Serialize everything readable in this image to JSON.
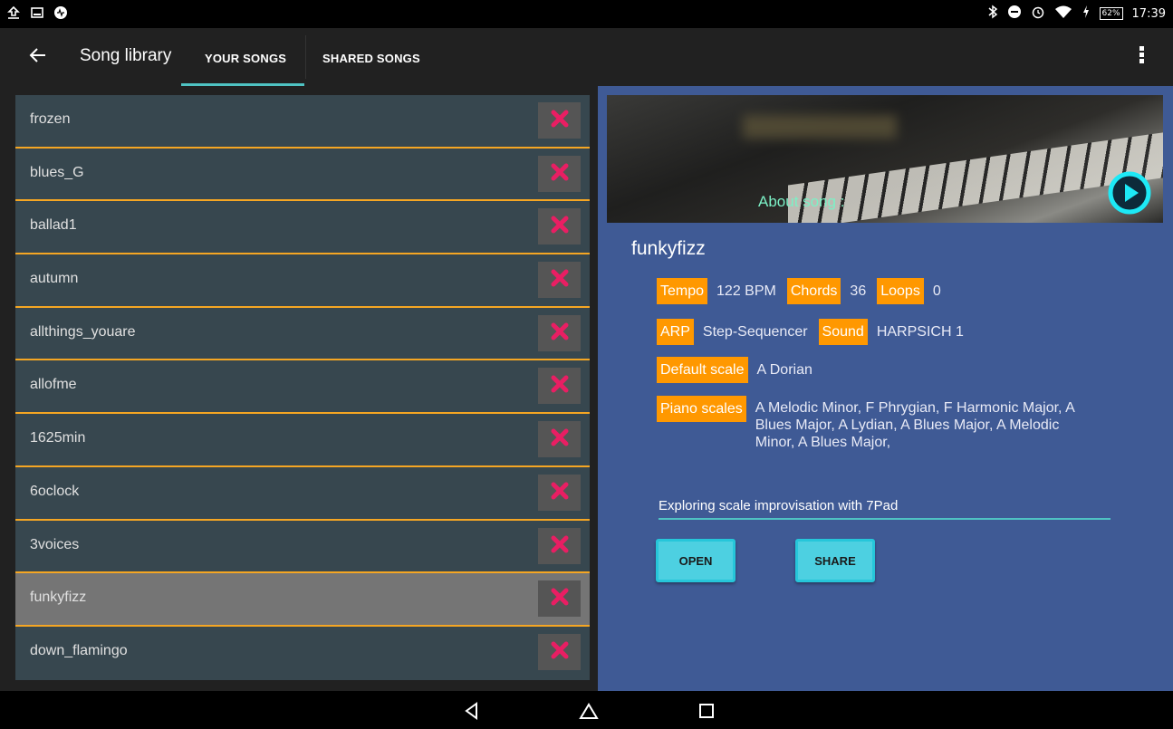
{
  "status_bar": {
    "left_icons": [
      "upload-icon",
      "image-icon",
      "app-notification-icon"
    ],
    "right_icons": [
      "bluetooth-icon",
      "do-not-disturb-icon",
      "alarm-icon",
      "wifi-icon",
      "charging-icon"
    ],
    "battery": "62%",
    "time": "17:39"
  },
  "app_bar": {
    "title": "Song library",
    "tabs": [
      {
        "label": "YOUR SONGS",
        "active": true
      },
      {
        "label": "SHARED SONGS",
        "active": false
      }
    ],
    "accent": "#4fc3c3"
  },
  "songs": [
    {
      "name": "frozen",
      "selected": false
    },
    {
      "name": "blues_G",
      "selected": false
    },
    {
      "name": "ballad1",
      "selected": false
    },
    {
      "name": "autumn",
      "selected": false
    },
    {
      "name": "allthings_youare",
      "selected": false
    },
    {
      "name": "allofme",
      "selected": false
    },
    {
      "name": "1625min",
      "selected": false
    },
    {
      "name": "6oclock",
      "selected": false
    },
    {
      "name": "3voices",
      "selected": false
    },
    {
      "name": "funkyfizz",
      "selected": true
    },
    {
      "name": "down_flamingo",
      "selected": false
    }
  ],
  "detail": {
    "about_label": "About song :",
    "song_title": "funkyfizz",
    "tempo_label": "Tempo",
    "tempo_value": "122 BPM",
    "chords_label": "Chords",
    "chords_value": "36",
    "loops_label": "Loops",
    "loops_value": "0",
    "arp_label": "ARP",
    "arp_value": "Step-Sequencer",
    "sound_label": "Sound",
    "sound_value": "HARPSICH 1",
    "default_scale_label": "Default scale",
    "default_scale_value": "A Dorian",
    "piano_scales_label": "Piano scales",
    "piano_scales_value": "A Melodic Minor, F Phrygian, F Harmonic Major, A Blues Major, A Lydian, A Blues Major, A Melodic Minor, A Blues Major,",
    "description": "Exploring scale improvisation with 7Pad",
    "open_label": "OPEN",
    "share_label": "SHARE"
  },
  "colors": {
    "tag": "#ff9800",
    "row": "#37474f",
    "row_selected": "#757575",
    "row_divider": "#f5a623",
    "detail_bg": "#3f5a95",
    "button": "#4dd0e1",
    "delete": "#e91e63"
  }
}
